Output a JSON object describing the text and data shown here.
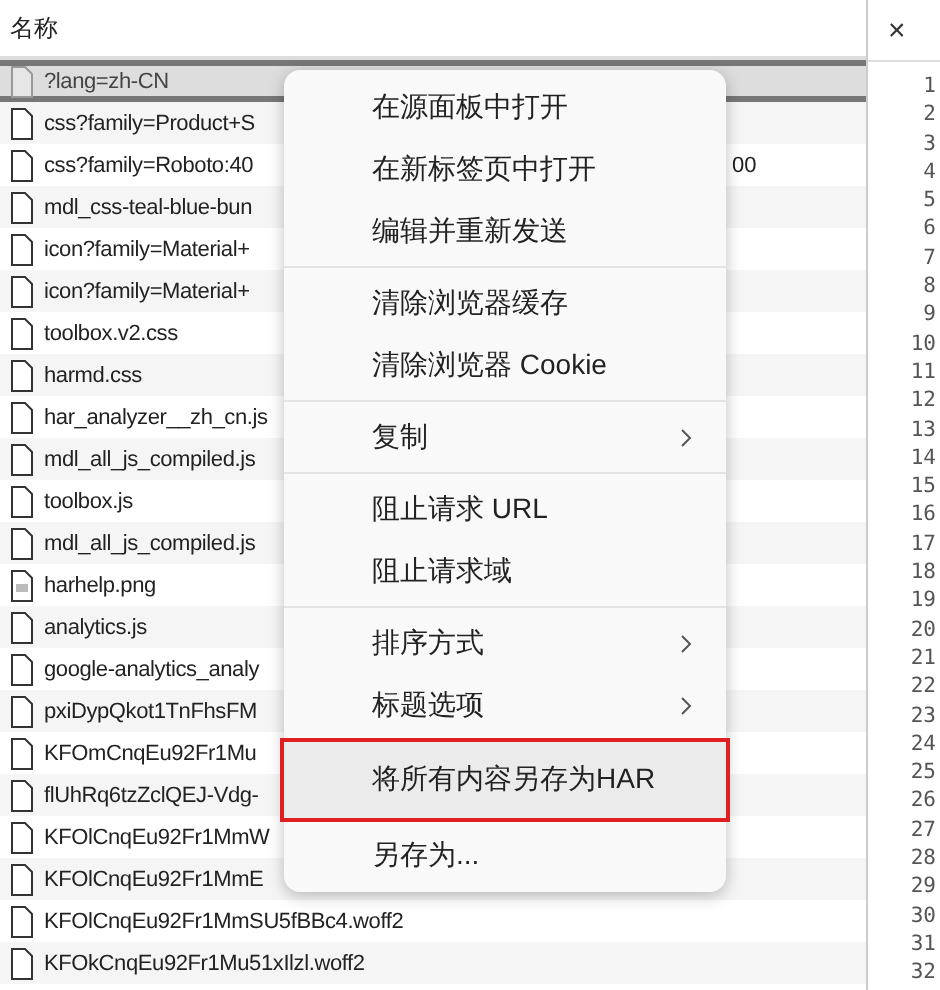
{
  "list_header": "名称",
  "rows": [
    {
      "name": "?lang=zh-CN",
      "kind": "file",
      "selected": true
    },
    {
      "name": "css?family=Product+S",
      "kind": "file",
      "selected": false
    },
    {
      "name": "css?family=Roboto:40",
      "tail": "00",
      "kind": "file",
      "selected": false
    },
    {
      "name": "mdl_css-teal-blue-bun",
      "kind": "file",
      "selected": false
    },
    {
      "name": "icon?family=Material+",
      "kind": "file",
      "selected": false
    },
    {
      "name": "icon?family=Material+",
      "kind": "file",
      "selected": false
    },
    {
      "name": "toolbox.v2.css",
      "kind": "file",
      "selected": false
    },
    {
      "name": "harmd.css",
      "kind": "file",
      "selected": false
    },
    {
      "name": "har_analyzer__zh_cn.js",
      "kind": "file",
      "selected": false
    },
    {
      "name": "mdl_all_js_compiled.js",
      "kind": "file",
      "selected": false
    },
    {
      "name": "toolbox.js",
      "kind": "file",
      "selected": false
    },
    {
      "name": "mdl_all_js_compiled.js",
      "kind": "file",
      "selected": false
    },
    {
      "name": "harhelp.png",
      "kind": "image",
      "selected": false
    },
    {
      "name": "analytics.js",
      "kind": "file",
      "selected": false
    },
    {
      "name": "google-analytics_analy",
      "kind": "file",
      "selected": false
    },
    {
      "name": "pxiDypQkot1TnFhsFM",
      "kind": "file",
      "selected": false
    },
    {
      "name": "KFOmCnqEu92Fr1Mu",
      "kind": "file",
      "selected": false
    },
    {
      "name": "flUhRq6tzZclQEJ-Vdg-",
      "kind": "file",
      "selected": false
    },
    {
      "name": "KFOlCnqEu92Fr1MmW",
      "kind": "file",
      "selected": false
    },
    {
      "name": "KFOlCnqEu92Fr1MmE",
      "kind": "file",
      "selected": false
    },
    {
      "name": "KFOlCnqEu92Fr1MmSU5fBBc4.woff2",
      "kind": "file",
      "selected": false
    },
    {
      "name": "KFOkCnqEu92Fr1Mu51xIlzl.woff2",
      "kind": "file",
      "selected": false
    }
  ],
  "preview": {
    "close": "×",
    "line_numbers": [
      "1",
      "2",
      "3",
      "4",
      "5",
      "6",
      "7",
      "8",
      "9",
      "10",
      "11",
      "12",
      "13",
      "14",
      "15",
      "16",
      "17",
      "18",
      "19",
      "20",
      "21",
      "22",
      "23",
      "24",
      "25",
      "26",
      "27",
      "28",
      "29",
      "30",
      "31",
      "32"
    ]
  },
  "context_menu": [
    {
      "kind": "item",
      "label": "在源面板中打开",
      "submenu": false,
      "hovered": false,
      "outlined": false
    },
    {
      "kind": "item",
      "label": "在新标签页中打开",
      "submenu": false,
      "hovered": false,
      "outlined": false
    },
    {
      "kind": "item",
      "label": "编辑并重新发送",
      "submenu": false,
      "hovered": false,
      "outlined": false
    },
    {
      "kind": "separator"
    },
    {
      "kind": "item",
      "label": "清除浏览器缓存",
      "submenu": false,
      "hovered": false,
      "outlined": false
    },
    {
      "kind": "item",
      "label": "清除浏览器 Cookie",
      "submenu": false,
      "hovered": false,
      "outlined": false
    },
    {
      "kind": "separator"
    },
    {
      "kind": "item",
      "label": "复制",
      "submenu": true,
      "hovered": false,
      "outlined": false
    },
    {
      "kind": "separator"
    },
    {
      "kind": "item",
      "label": "阻止请求 URL",
      "submenu": false,
      "hovered": false,
      "outlined": false
    },
    {
      "kind": "item",
      "label": "阻止请求域",
      "submenu": false,
      "hovered": false,
      "outlined": false
    },
    {
      "kind": "separator"
    },
    {
      "kind": "item",
      "label": "排序方式",
      "submenu": true,
      "hovered": false,
      "outlined": false
    },
    {
      "kind": "item",
      "label": "标题选项",
      "submenu": true,
      "hovered": false,
      "outlined": false
    },
    {
      "kind": "item",
      "label": "将所有内容另存为HAR",
      "submenu": false,
      "hovered": true,
      "outlined": true
    },
    {
      "kind": "item",
      "label": "另存为...",
      "submenu": false,
      "hovered": false,
      "outlined": false
    }
  ]
}
